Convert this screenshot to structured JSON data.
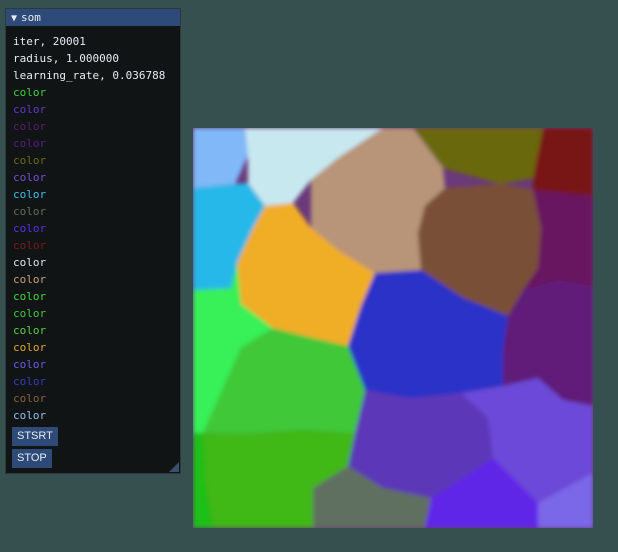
{
  "window": {
    "title": "som",
    "collapse_glyph": "▼",
    "stats": {
      "iter": "iter, 20001",
      "radius": "radius, 1.000000",
      "learning_rate": "learning_rate, 0.036788"
    },
    "colors": [
      {
        "label": "color",
        "color": "#3fd03f"
      },
      {
        "label": "color",
        "color": "#6a32c8"
      },
      {
        "label": "color",
        "color": "#5a1e6c"
      },
      {
        "label": "color",
        "color": "#5a1e8a"
      },
      {
        "label": "color",
        "color": "#6e6a10"
      },
      {
        "label": "color",
        "color": "#7a4cd8"
      },
      {
        "label": "color",
        "color": "#3cc0e8"
      },
      {
        "label": "color",
        "color": "#6a6a5c"
      },
      {
        "label": "color",
        "color": "#5a2ee0"
      },
      {
        "label": "color",
        "color": "#7a1a1a"
      },
      {
        "label": "color",
        "color": "#e0e4e8"
      },
      {
        "label": "color",
        "color": "#c4a080"
      },
      {
        "label": "color",
        "color": "#40d840"
      },
      {
        "label": "color",
        "color": "#40c840"
      },
      {
        "label": "color",
        "color": "#5ad040"
      },
      {
        "label": "color",
        "color": "#e0a830"
      },
      {
        "label": "color",
        "color": "#6a5ae0"
      },
      {
        "label": "color",
        "color": "#3a3ab8"
      },
      {
        "label": "color",
        "color": "#8a6040"
      },
      {
        "label": "color",
        "color": "#90c0f0"
      }
    ],
    "buttons": {
      "start": "STSRT",
      "stop": "STOP"
    }
  },
  "theme": {
    "background": "#364f4f",
    "panel": "#111414",
    "titlebar": "#2e4a78",
    "button": "#2e4a78",
    "text": "#e8ecf2"
  },
  "som_map": {
    "cells": [
      {
        "name": "light-blue",
        "color": "#80b8f8"
      },
      {
        "name": "pale-cyan",
        "color": "#c8e8f0"
      },
      {
        "name": "tan",
        "color": "#b89478"
      },
      {
        "name": "olive",
        "color": "#6a6810"
      },
      {
        "name": "dark-red",
        "color": "#781818"
      },
      {
        "name": "sky-blue",
        "color": "#28b8e8"
      },
      {
        "name": "brown",
        "color": "#7a5038"
      },
      {
        "name": "plum",
        "color": "#681860"
      },
      {
        "name": "orange",
        "color": "#f0ae28"
      },
      {
        "name": "royal-blue",
        "color": "#2a30c8"
      },
      {
        "name": "purple",
        "color": "#601c78"
      },
      {
        "name": "bright-green",
        "color": "#38f058"
      },
      {
        "name": "green",
        "color": "#40c838"
      },
      {
        "name": "indigo",
        "color": "#5c38b8"
      },
      {
        "name": "violet",
        "color": "#6c48d8"
      },
      {
        "name": "lime-green",
        "color": "#40b818"
      },
      {
        "name": "green-2",
        "color": "#1cc018"
      },
      {
        "name": "gray",
        "color": "#607060"
      },
      {
        "name": "blue-violet",
        "color": "#6028e8"
      },
      {
        "name": "lavender",
        "color": "#7a68e8"
      }
    ]
  }
}
